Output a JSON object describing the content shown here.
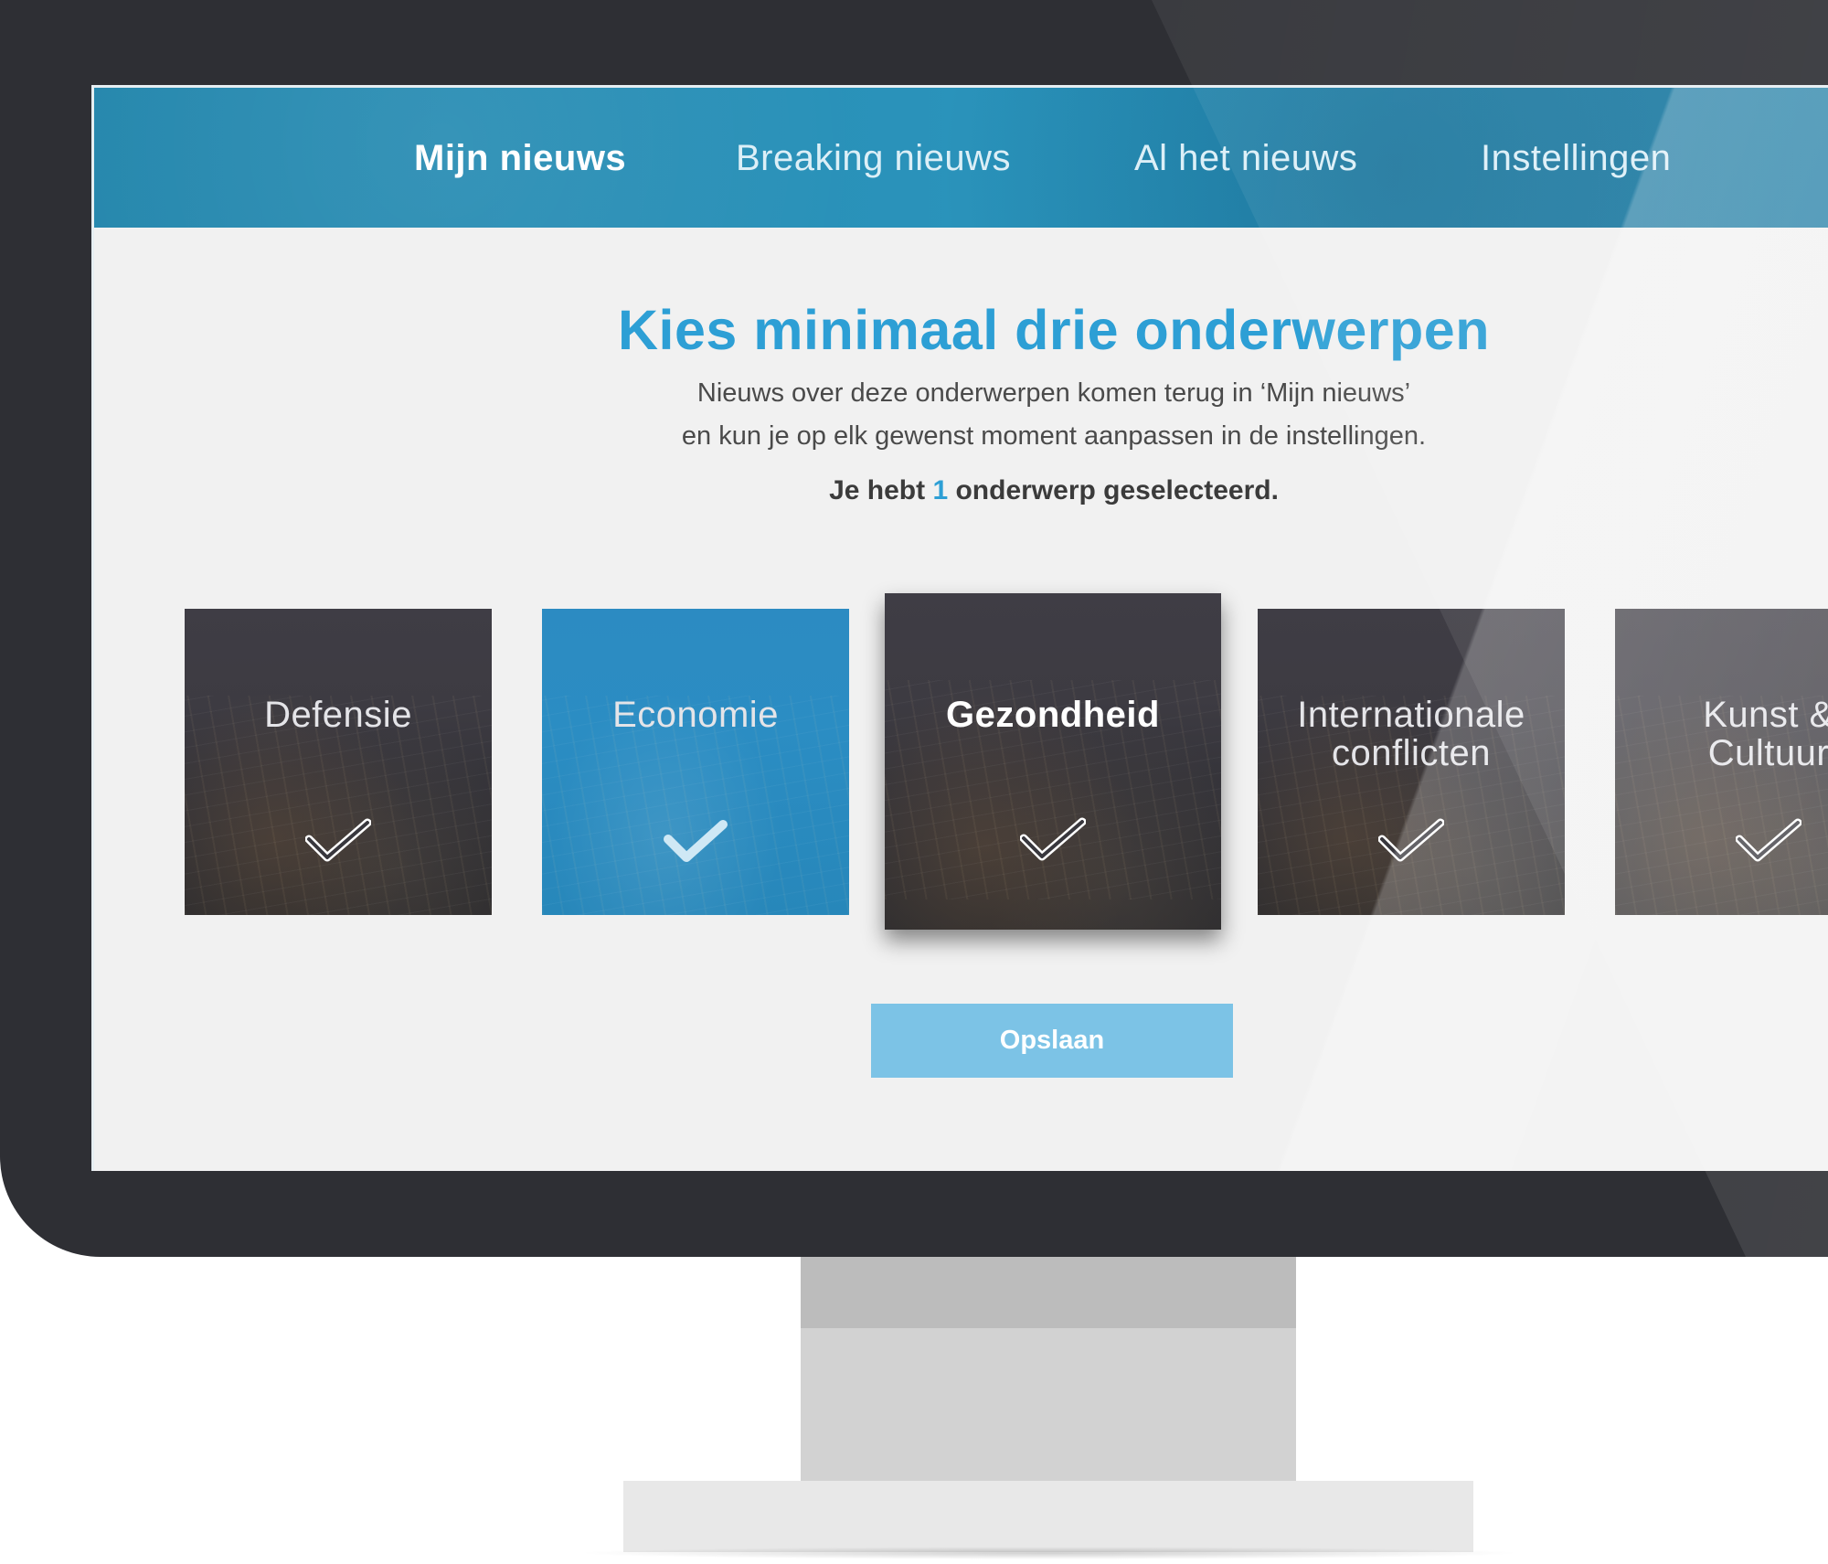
{
  "nav": {
    "items": [
      {
        "label": "Mijn nieuws",
        "active": true
      },
      {
        "label": "Breaking nieuws",
        "active": false
      },
      {
        "label": "Al het nieuws",
        "active": false
      },
      {
        "label": "Instellingen",
        "active": false
      }
    ]
  },
  "main": {
    "title": "Kies minimaal drie onderwerpen",
    "subtitle_line1": "Nieuws over deze onderwerpen komen terug in ‘Mijn nieuws’",
    "subtitle_line2": "en kun je op elk gewenst moment aanpassen in de instellingen.",
    "selection_prefix": "Je hebt",
    "selection_count": "1",
    "selection_suffix": "onderwerp geselecteerd."
  },
  "topics": [
    {
      "line1": "Defensie",
      "line2": "",
      "selected": false
    },
    {
      "line1": "Economie",
      "line2": "",
      "selected": true
    },
    {
      "line1": "Gezondheid",
      "line2": "",
      "selected": false,
      "hovered": true
    },
    {
      "line1": "Internationale",
      "line2": "conflicten",
      "selected": false
    },
    {
      "line1": "Kunst &",
      "line2": "Cultuur",
      "selected": false
    }
  ],
  "icons": {
    "check": "checkmark-icon"
  },
  "save_label": "Opslaan",
  "colors": {
    "accent": "#2d9fd5",
    "nav_background": "#2a8fb8",
    "selected_tile": "#2b8dc3",
    "save_button": "#7cc3e6"
  }
}
